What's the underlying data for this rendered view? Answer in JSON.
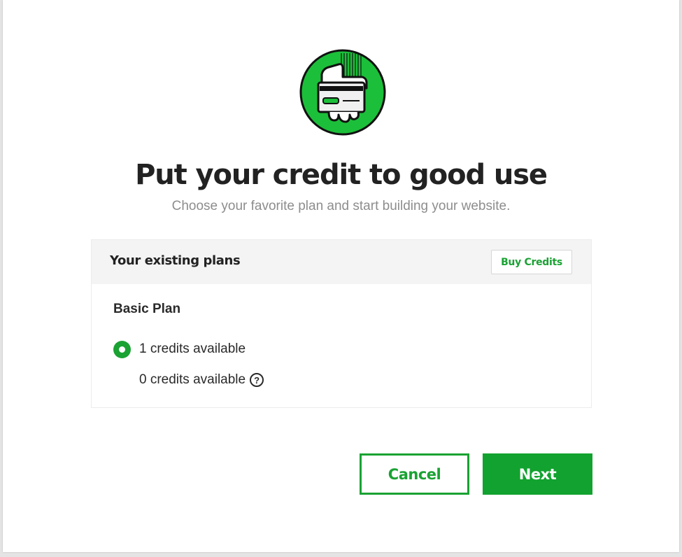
{
  "dialog": {
    "hero_icon": "hand-holding-credit-card-icon",
    "title": "Put your credit to good use",
    "subtitle": "Choose your favorite plan and start building your website."
  },
  "plans": {
    "header_title": "Your existing plans",
    "buy_credits_label": "Buy Credits",
    "plan_name": "Basic Plan",
    "options": [
      {
        "label": "1 credits available",
        "selected": true
      },
      {
        "label": "0 credits available",
        "selected": false,
        "help_icon": "question-circle-icon"
      }
    ]
  },
  "actions": {
    "cancel_label": "Cancel",
    "next_label": "Next"
  },
  "colors": {
    "accent": "#1aa233",
    "title": "#222222",
    "subtitle": "#8d8d8d",
    "panel_header": "#f4f4f4"
  }
}
